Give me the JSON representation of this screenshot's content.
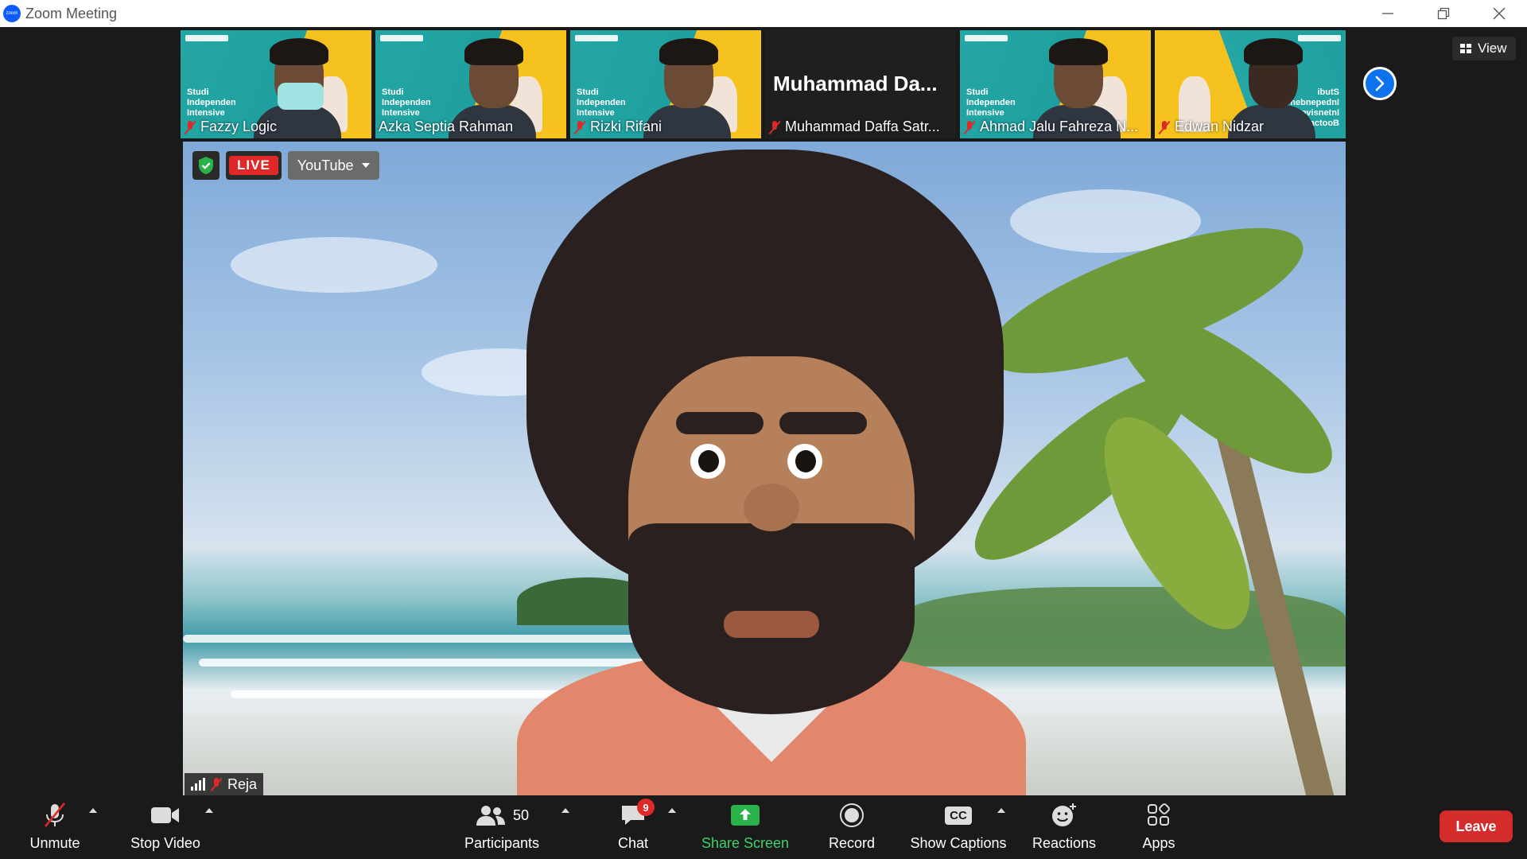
{
  "window": {
    "title": "Zoom Meeting",
    "app_icon_text": "zoom"
  },
  "thumbnails": [
    {
      "name": "Fazzy Logic",
      "caption": "Studi Independen Intensive",
      "style": "teal",
      "muted": true
    },
    {
      "name": "Azka Septia Rahman",
      "caption": "Studi Independen Intensive",
      "style": "teal",
      "muted": false
    },
    {
      "name": "Rizki Rifani",
      "caption": "Studi Independen Intensive",
      "style": "teal",
      "muted": true
    },
    {
      "name": "Muhammad Daffa Satr...",
      "display_title": "Muhammad  Da...",
      "style": "dark",
      "muted": true
    },
    {
      "name": "Ahmad Jalu Fahreza N...",
      "caption": "Studi Independen Intensive",
      "style": "teal",
      "muted": true
    },
    {
      "name": "Edwan Nidzar",
      "caption": "ibutS nebnepednI evisnetnI pmactooB",
      "style": "mirror",
      "muted": true
    }
  ],
  "view_button": {
    "label": "View"
  },
  "main_video": {
    "speaker": "Reja",
    "live_badge": "LIVE",
    "stream_target": "YouTube"
  },
  "toolbar": {
    "unmute": "Unmute",
    "stop_video": "Stop Video",
    "participants": "Participants",
    "participants_count": "50",
    "chat": "Chat",
    "chat_badge": "9",
    "share_screen": "Share Screen",
    "record": "Record",
    "show_captions": "Show Captions",
    "captions_icon_text": "CC",
    "reactions": "Reactions",
    "apps": "Apps",
    "leave": "Leave"
  },
  "colors": {
    "accent": "#0e72ed",
    "live": "#e02828",
    "share": "#3ed06a",
    "leave": "#d42b2b",
    "background": "#1a1a1a"
  }
}
